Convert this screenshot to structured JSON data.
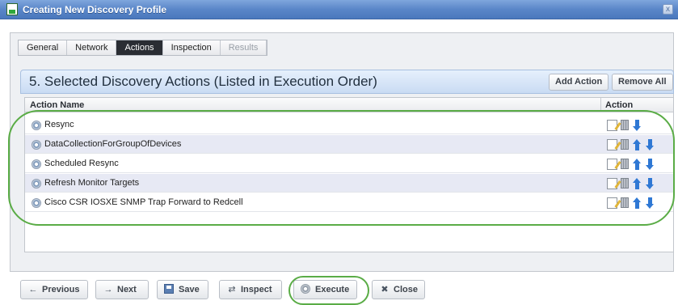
{
  "window": {
    "title": "Creating New Discovery Profile",
    "close_glyph": "x"
  },
  "tabs": [
    {
      "label": "General",
      "state": "normal"
    },
    {
      "label": "Network",
      "state": "normal"
    },
    {
      "label": "Actions",
      "state": "active"
    },
    {
      "label": "Inspection",
      "state": "normal"
    },
    {
      "label": "Results",
      "state": "disabled"
    }
  ],
  "panel": {
    "title": "5. Selected Discovery Actions (Listed in Execution Order)",
    "add_action_label": "Add Action",
    "remove_all_label": "Remove All"
  },
  "grid": {
    "columns": [
      "Action Name",
      "Action"
    ],
    "rows": [
      {
        "name": "Resync",
        "can_move_up": false,
        "can_move_down": true
      },
      {
        "name": "DataCollectionForGroupOfDevices",
        "can_move_up": true,
        "can_move_down": true
      },
      {
        "name": "Scheduled Resync",
        "can_move_up": true,
        "can_move_down": true
      },
      {
        "name": "Refresh Monitor Targets",
        "can_move_up": true,
        "can_move_down": true
      },
      {
        "name": "Cisco CSR IOSXE SNMP Trap Forward to Redcell",
        "can_move_up": true,
        "can_move_down": true
      }
    ]
  },
  "buttons": {
    "previous": {
      "label": "Previous",
      "icon": "←"
    },
    "next": {
      "label": "Next",
      "icon": "→"
    },
    "save": {
      "label": "Save"
    },
    "inspect": {
      "label": "Inspect",
      "icon": "⇄"
    },
    "execute": {
      "label": "Execute"
    },
    "close": {
      "label": "Close",
      "icon": "✖"
    }
  },
  "colors": {
    "titlebar": "#5a86c8",
    "active_tab": "#2a2d33",
    "alt_row": "#e7e9f4",
    "arrow": "#2f78d4",
    "highlight": "#5aac46"
  }
}
